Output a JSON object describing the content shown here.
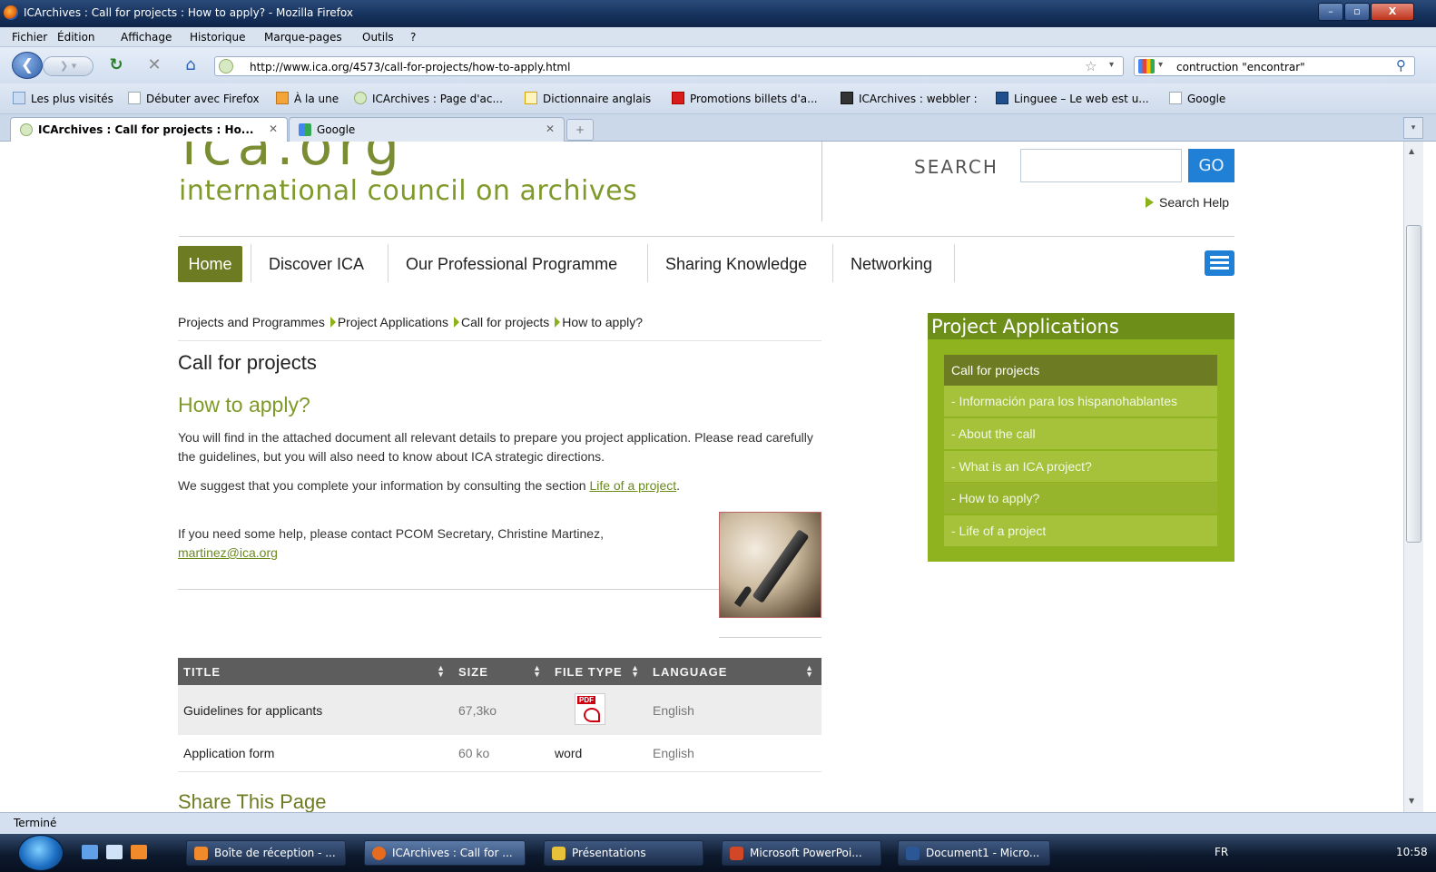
{
  "window": {
    "title": "ICArchives : Call for projects : How to apply? - Mozilla Firefox",
    "controls": {
      "minimize": "–",
      "maximize": "▫",
      "close": "X"
    }
  },
  "menu": [
    "Fichier",
    "Édition",
    "Affichage",
    "Historique",
    "Marque-pages",
    "Outils",
    "?"
  ],
  "toolbar": {
    "url": "http://www.ica.org/4573/call-for-projects/how-to-apply.html",
    "search_value": "contruction \"encontrar\""
  },
  "bookmarks": [
    "Les plus visités",
    "Débuter avec Firefox",
    "À la une",
    "ICArchives : Page d'ac...",
    "Dictionnaire anglais",
    "Promotions billets d'a...",
    "ICArchives : webbler :",
    "Linguee – Le web est u...",
    "Google"
  ],
  "tabs": [
    {
      "label": "ICArchives : Call for projects : Ho...",
      "active": true
    },
    {
      "label": "Google",
      "active": false
    }
  ],
  "site": {
    "logo_mark": "ica.org",
    "logo_sub": "international council on archives",
    "search_label": "SEARCH",
    "go_label": "GO",
    "search_help": "Search Help",
    "nav": [
      "Home",
      "Discover ICA",
      "Our Professional Programme",
      "Sharing Knowledge",
      "Networking"
    ]
  },
  "breadcrumb": [
    "Projects and Programmes",
    "Project Applications",
    "Call for projects",
    "How to apply?"
  ],
  "content": {
    "title": "Call for projects",
    "subtitle": "How to apply?",
    "para1": "You will find in the attached document all relevant details to prepare you project application. Please read carefully the guidelines, but you will also need to know about ICA strategic directions.",
    "para2_text": "We suggest that you complete your information by consulting the section ",
    "para2_link": "Life of a project",
    "para2_end": ".",
    "para3_text": "If you need some help, please contact PCOM Secretary, Christine Martinez, ",
    "para3_link": "martinez@ica.org",
    "share_title": "Share This Page"
  },
  "table": {
    "headers": [
      "TITLE",
      "SIZE",
      "FILE TYPE",
      "LANGUAGE"
    ],
    "rows": [
      {
        "title": "Guidelines for applicants",
        "size": "67,3ko",
        "type": "pdf",
        "language": "English"
      },
      {
        "title": "Application form",
        "size": "60 ko",
        "type": "word",
        "language": "English"
      }
    ]
  },
  "sidebar": {
    "heading": "Project Applications",
    "items": [
      "Call for projects",
      "- Información para los hispanohablantes",
      "- About the call",
      "- What is an ICA project?",
      "- How to apply?",
      "- Life of a project"
    ]
  },
  "status": "Terminé",
  "taskbar": {
    "items": [
      "Boîte de réception - ...",
      "ICArchives : Call for ...",
      "Présentations",
      "Microsoft PowerPoi...",
      "Document1 - Micro..."
    ],
    "lang": "FR",
    "clock": "10:58"
  },
  "colors": {
    "accent": "#7f9a2a",
    "nav_active": "#6d7c22",
    "sidebar": "#8fb21f",
    "go_button": "#1f80d6"
  }
}
